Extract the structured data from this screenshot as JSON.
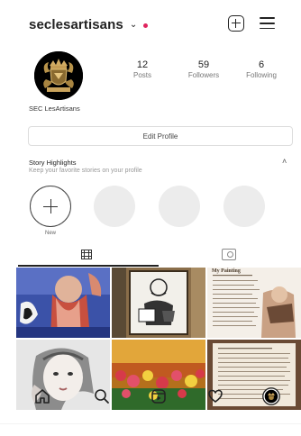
{
  "header": {
    "username": "seclesartisans",
    "dropdown_glyph": "⌄",
    "new_post_icon": "plus-square-icon",
    "menu_icon": "hamburger-icon"
  },
  "profile": {
    "display_name": "SEC LesArtisans",
    "stats": [
      {
        "value": "12",
        "label": "Posts"
      },
      {
        "value": "59",
        "label": "Followers"
      },
      {
        "value": "6",
        "label": "Following"
      }
    ],
    "edit_button_label": "Edit Profile"
  },
  "highlights": {
    "title": "Story Highlights",
    "subtitle": "Keep your favorite stories on your profile",
    "collapse_glyph": "˄",
    "new_label": "New"
  },
  "tabs": [
    {
      "icon": "grid-icon"
    },
    {
      "icon": "tagged-icon"
    }
  ],
  "bottom_nav": [
    {
      "icon": "home-icon"
    },
    {
      "icon": "search-icon"
    },
    {
      "icon": "reels-icon"
    },
    {
      "icon": "heart-icon"
    },
    {
      "icon": "profile-avatar-icon"
    }
  ],
  "grid_post_texts": {
    "post_3_heading": "My Painting"
  },
  "colors": {
    "notification_dot": "#e0245e",
    "text": "#222222",
    "muted": "#777777"
  }
}
